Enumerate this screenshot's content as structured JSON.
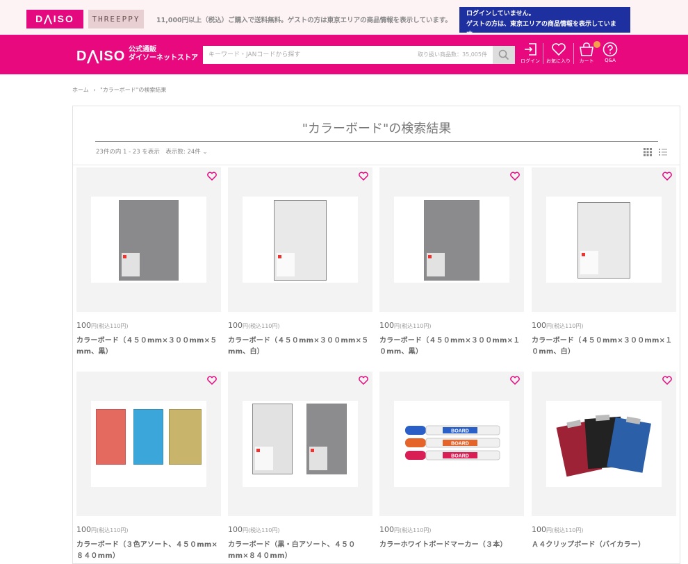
{
  "topbar": {
    "tab_daiso": "D⋀ISO",
    "tab_threeppy": "THREEPPY",
    "shipping_notice": "11,000円以上（税込）ご購入で送料無料。ゲストの方は東京エリアの商品情報を表示しています。",
    "login_notice_line1": "ログインしていません。",
    "login_notice_line2": "ゲストの方は、東京エリアの商品情報を表示しています。"
  },
  "header": {
    "logo": "D⋀ISO",
    "logo_sub_line1": "公式通販",
    "logo_sub_line2": "ダイソーネットストア",
    "search_placeholder": "キーワード・JANコードから探す",
    "search_count": "取り扱い商品数：35,005件",
    "login_label": "ログイン",
    "favorites_label": "お気に入り",
    "cart_label": "カート",
    "qa_label": "Q&A"
  },
  "breadcrumb": {
    "home": "ホーム",
    "separator": "›",
    "current": "\"カラーボード\"の検索結果"
  },
  "results": {
    "title": "\"カラーボード\"の検索結果",
    "count_text": "23件の内 1 - 23 を表示　表示数: 24件 ⌄"
  },
  "colors": {
    "brand_pink": "#e8097f",
    "login_blue": "#1e2fa0",
    "heart_pink": "#e5097f"
  },
  "products": [
    {
      "price": "100",
      "yen": "円",
      "tax": "(税込110円)",
      "name": "カラーボード（４５０mm×３００mm×５mm、黒）",
      "image": "black-board"
    },
    {
      "price": "100",
      "yen": "円",
      "tax": "(税込110円)",
      "name": "カラーボード（４５０mm×３００mm×５mm、白）",
      "image": "white-board"
    },
    {
      "price": "100",
      "yen": "円",
      "tax": "(税込110円)",
      "name": "カラーボード（４５０mm×３００mm×１０mm、黒）",
      "image": "black-board"
    },
    {
      "price": "100",
      "yen": "円",
      "tax": "(税込110円)",
      "name": "カラーボード（４５０mm×３００mm×１０mm、白）",
      "image": "white-board"
    },
    {
      "price": "100",
      "yen": "円",
      "tax": "(税込110円)",
      "name": "カラーボード（３色アソート、４５０mm×８４０mm）",
      "image": "three-color-boards"
    },
    {
      "price": "100",
      "yen": "円",
      "tax": "(税込110円)",
      "name": "カラーボード（黒・白アソート、４５０mm×８４０mm）",
      "image": "black-white-boards"
    },
    {
      "price": "100",
      "yen": "円",
      "tax": "(税込110円)",
      "name": "カラーホワイトボードマーカー（３本）",
      "image": "board-markers"
    },
    {
      "price": "100",
      "yen": "円",
      "tax": "(税込110円)",
      "name": "Ａ４クリップボード（バイカラー）",
      "image": "clipboards"
    }
  ]
}
